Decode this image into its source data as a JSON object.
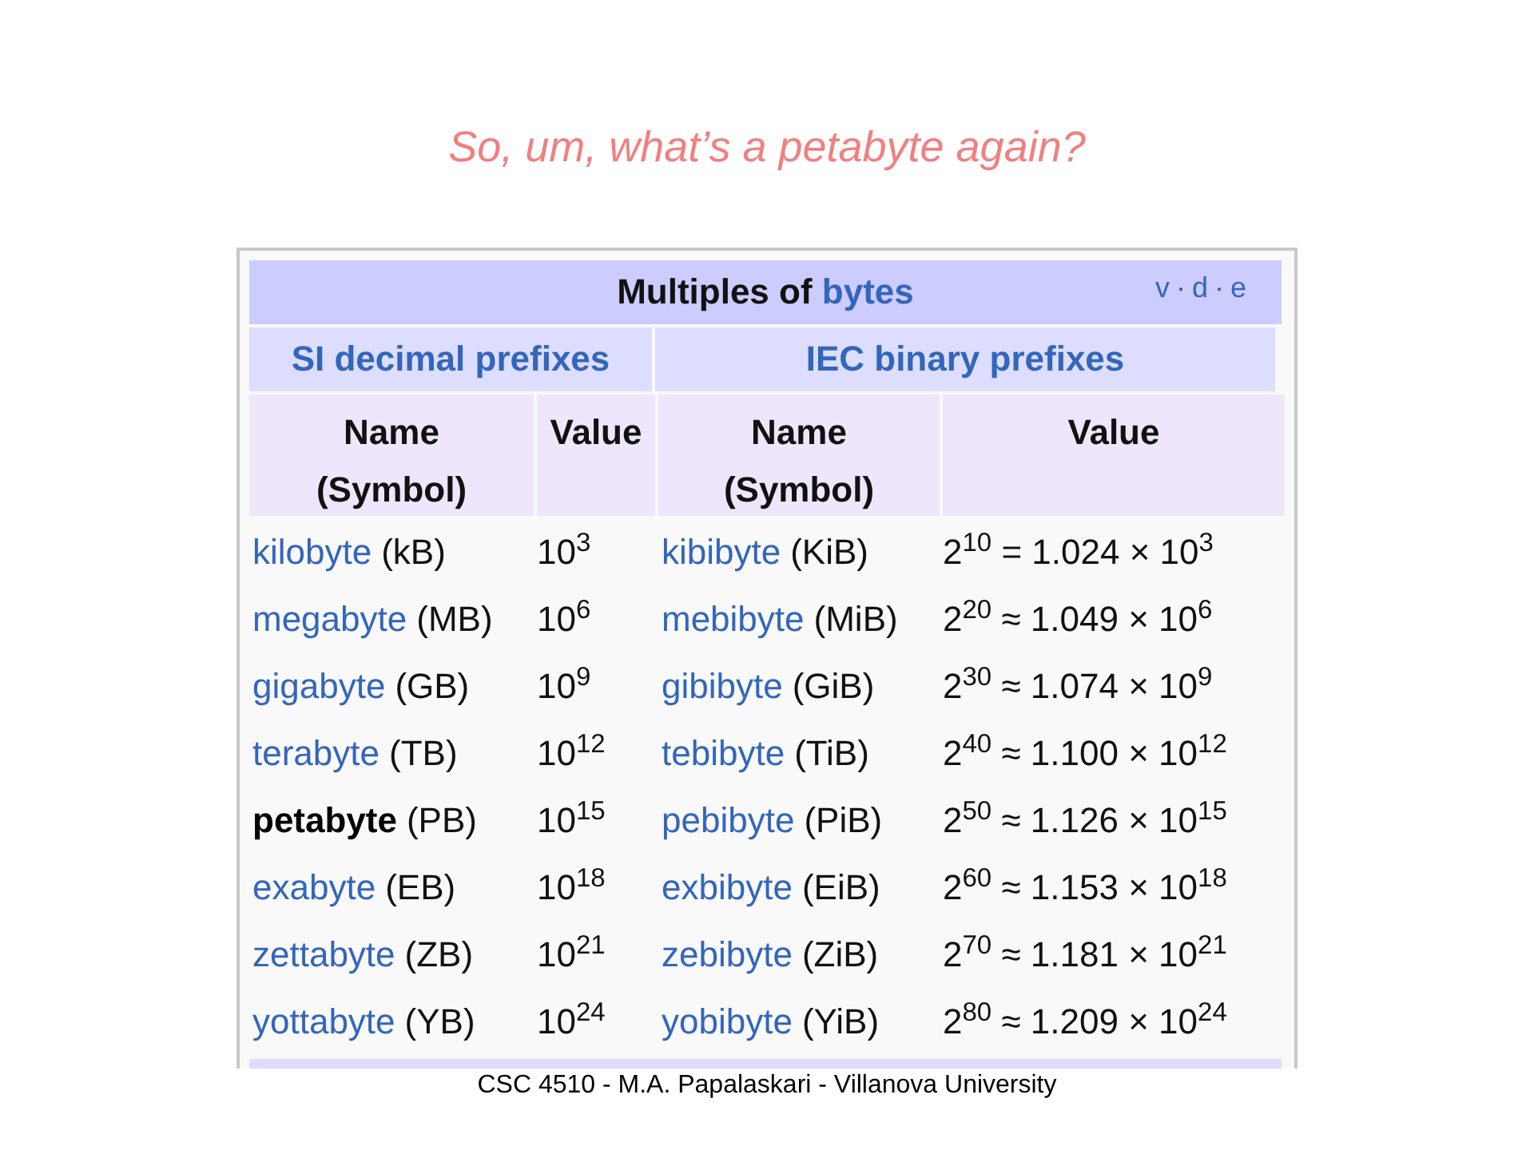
{
  "slide_title": "So, um, what’s a petabyte again?",
  "table": {
    "heading_text": "Multiples of",
    "heading_link": "bytes",
    "nav_links": [
      "v",
      "d",
      "e"
    ],
    "nav_separator": "·",
    "groups": [
      "SI decimal prefixes",
      "IEC binary prefixes"
    ],
    "columns": [
      {
        "lines": [
          "Name",
          "(Symbol)"
        ]
      },
      {
        "lines": [
          "Value"
        ]
      },
      {
        "lines": [
          "Name",
          "(Symbol)"
        ]
      },
      {
        "lines": [
          "Value"
        ]
      }
    ],
    "rows": [
      {
        "si_name": "kilobyte",
        "si_symbol": "(kB)",
        "si_value": "10$^{3}$",
        "iec_name": "kibibyte",
        "iec_symbol": "(KiB)",
        "iec_value": "2$^{10}$ = 1.024 × 10$^{3}$",
        "current": false
      },
      {
        "si_name": "megabyte",
        "si_symbol": "(MB)",
        "si_value": "10$^{6}$",
        "iec_name": "mebibyte",
        "iec_symbol": "(MiB)",
        "iec_value": "2$^{20}$ ≈ 1.049 × 10$^{6}$",
        "current": false
      },
      {
        "si_name": "gigabyte",
        "si_symbol": "(GB)",
        "si_value": "10$^{9}$",
        "iec_name": "gibibyte",
        "iec_symbol": "(GiB)",
        "iec_value": "2$^{30}$ ≈ 1.074 × 10$^{9}$",
        "current": false
      },
      {
        "si_name": "terabyte",
        "si_symbol": "(TB)",
        "si_value": "10$^{12}$",
        "iec_name": "tebibyte",
        "iec_symbol": "(TiB)",
        "iec_value": "2$^{40}$ ≈ 1.100 × 10$^{12}$",
        "current": false
      },
      {
        "si_name": "petabyte",
        "si_symbol": "(PB)",
        "si_value": "10$^{15}$",
        "iec_name": "pebibyte",
        "iec_symbol": "(PiB)",
        "iec_value": "2$^{50}$ ≈ 1.126 × 10$^{15}$",
        "current": true
      },
      {
        "si_name": "exabyte",
        "si_symbol": "(EB)",
        "si_value": "10$^{18}$",
        "iec_name": "exbibyte",
        "iec_symbol": "(EiB)",
        "iec_value": "2$^{60}$ ≈ 1.153 × 10$^{18}$",
        "current": false
      },
      {
        "si_name": "zettabyte",
        "si_symbol": "(ZB)",
        "si_value": "10$^{21}$",
        "iec_name": "zebibyte",
        "iec_symbol": "(ZiB)",
        "iec_value": "2$^{70}$ ≈ 1.181 × 10$^{21}$",
        "current": false
      },
      {
        "si_name": "yottabyte",
        "si_symbol": "(YB)",
        "si_value": "10$^{24}$",
        "iec_name": "yobibyte",
        "iec_symbol": "(YiB)",
        "iec_value": "2$^{80}$ ≈ 1.209 × 10$^{24}$",
        "current": false
      }
    ]
  },
  "footer": "CSC 4510 - M.A. Papalaskari - Villanova University"
}
